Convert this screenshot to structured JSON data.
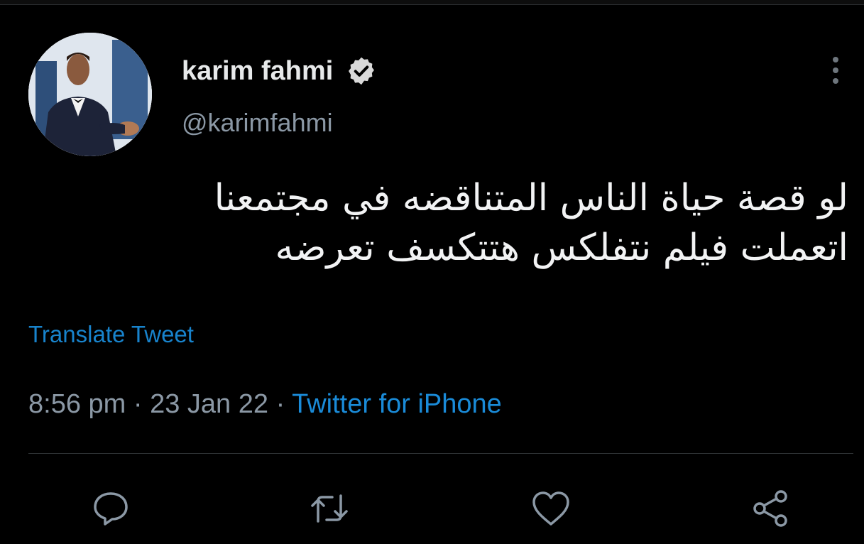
{
  "tweet": {
    "author": {
      "display_name": "karim fahmi",
      "handle": "@karimfahmi",
      "avatar_icon": "profile-photo",
      "verified_icon": "verified-badge-icon"
    },
    "text_lines": [
      "لو  قصة حياة الناس المتناقضه في مجتمعنا",
      "اتعملت فيلم نتفلكس هتتكسف تعرضه"
    ],
    "translate_label": "Translate Tweet",
    "meta": {
      "time": "8:56 pm",
      "separator": "·",
      "date": "23 Jan 22",
      "source": "Twitter for iPhone"
    },
    "actions": [
      {
        "name": "reply",
        "icon": "reply-icon"
      },
      {
        "name": "retweet",
        "icon": "retweet-icon"
      },
      {
        "name": "like",
        "icon": "heart-icon"
      },
      {
        "name": "share",
        "icon": "share-icon"
      }
    ]
  },
  "colors": {
    "background": "#000000",
    "text_primary": "#e7e9ea",
    "text_secondary": "#8b98a5",
    "accent": "#1d9bf0",
    "divider": "#2f3336"
  }
}
